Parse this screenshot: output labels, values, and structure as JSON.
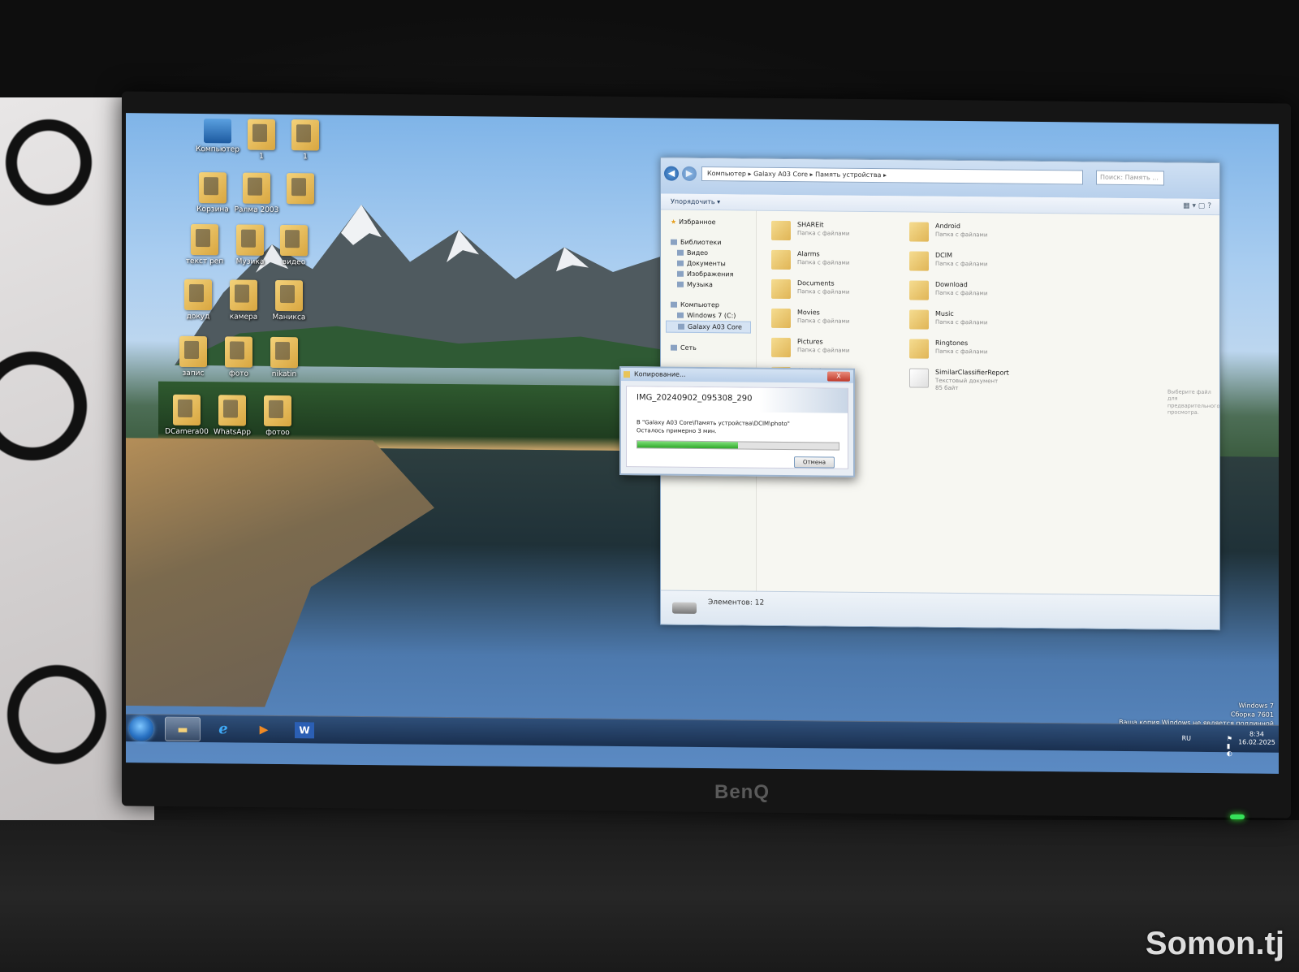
{
  "watermark": "Somon.tj",
  "monitor_brand": "BenQ",
  "desktop_icons": [
    {
      "label": "Компьютер",
      "kind": "pc"
    },
    {
      "label": "1",
      "kind": "folder"
    },
    {
      "label": "1",
      "kind": "folder"
    },
    {
      "label": "Корзина",
      "kind": "folder"
    },
    {
      "label": "Ралма 2003",
      "kind": "folder"
    },
    {
      "label": "",
      "kind": "folder"
    },
    {
      "label": "текст реп",
      "kind": "folder"
    },
    {
      "label": "Музика",
      "kind": "folder"
    },
    {
      "label": "видео",
      "kind": "folder"
    },
    {
      "label": "докуд",
      "kind": "folder"
    },
    {
      "label": "камера",
      "kind": "folder"
    },
    {
      "label": "Маникса",
      "kind": "folder"
    },
    {
      "label": "запис",
      "kind": "folder"
    },
    {
      "label": "фото",
      "kind": "folder"
    },
    {
      "label": "nikatin",
      "kind": "folder"
    },
    {
      "label": "DCamera00",
      "kind": "folder"
    },
    {
      "label": "WhatsApp",
      "kind": "folder"
    },
    {
      "label": "фотоо",
      "kind": "folder"
    }
  ],
  "explorer": {
    "address": [
      "Компьютер",
      "Galaxy A03 Core",
      "Память устройства"
    ],
    "search_placeholder": "Поиск: Память ...",
    "toolbar": {
      "organize": "Упорядочить ▾"
    },
    "nav": {
      "favorites": "Избранное",
      "libraries": "Библиотеки",
      "lib_items": [
        "Видео",
        "Документы",
        "Изображения",
        "Музыка"
      ],
      "computer": "Компьютер",
      "computer_items": [
        "Windows 7 (C:)",
        "Galaxy A03 Core"
      ],
      "network": "Сеть"
    },
    "files": [
      {
        "name": "SHAREit",
        "type": "Папка с файлами"
      },
      {
        "name": "Android",
        "type": "Папка с файлами"
      },
      {
        "name": "Alarms",
        "type": "Папка с файлами"
      },
      {
        "name": "DCIM",
        "type": "Папка с файлами"
      },
      {
        "name": "Documents",
        "type": "Папка с файлами"
      },
      {
        "name": "Download",
        "type": "Папка с файлами"
      },
      {
        "name": "Movies",
        "type": "Папка с файлами"
      },
      {
        "name": "Music",
        "type": "Папка с файлами"
      },
      {
        "name": "Pictures",
        "type": "Папка с файлами"
      },
      {
        "name": "Ringtones",
        "type": "Папка с файлами"
      },
      {
        "name": "SHAREit",
        "type": "Папка с файлами"
      },
      {
        "name": "SimilarClassifierReport",
        "type": "Текстовый документ",
        "size": "85 байт"
      }
    ],
    "hint": "Выберите файл для предварительного просмотра.",
    "status": "Элементов: 12"
  },
  "copy_dialog": {
    "title": "Копирование...",
    "close_label": "X",
    "filename": "IMG_20240902_095308_290",
    "destination": "В \"Galaxy A03 Core\\Память устройства\\DCIM\\photo\"",
    "remaining": "Осталось примерно 3 мин.",
    "progress": 0.5,
    "cancel_label": "Отмена"
  },
  "activation": [
    "Windows 7",
    "Сборка 7601",
    "Ваша копия Windows не является подлинной"
  ],
  "taskbar": {
    "apps": [
      "explorer",
      "internet-explorer",
      "media-player",
      "word"
    ],
    "word_label": "W",
    "ie_label": "e",
    "media_label": "▶",
    "lang": "RU",
    "time": "8:34",
    "date": "16.02.2025"
  }
}
